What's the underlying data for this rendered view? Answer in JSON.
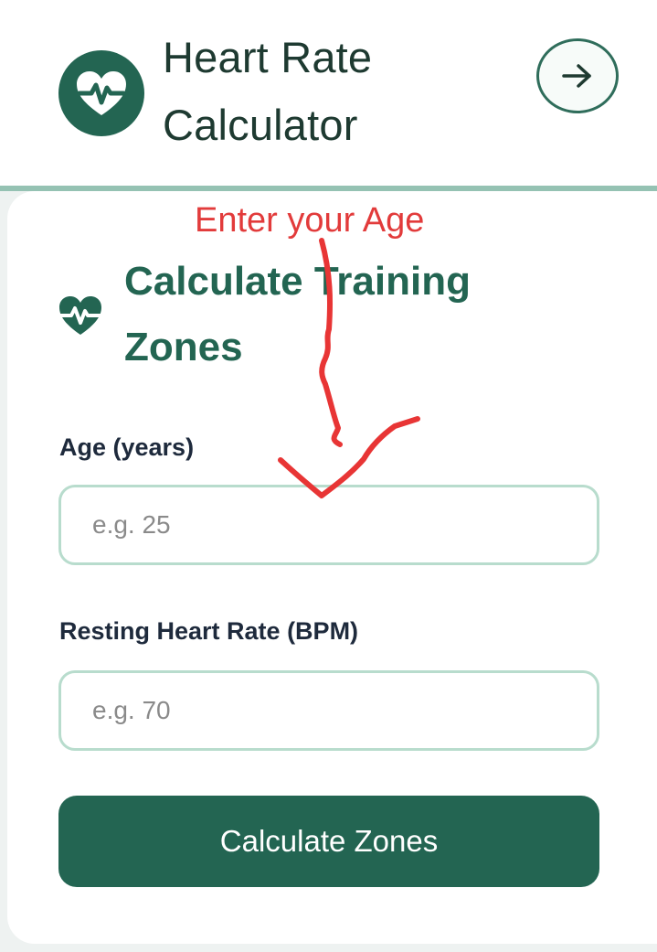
{
  "header": {
    "title": "Heart Rate Calculator"
  },
  "section": {
    "title": "Calculate Training Zones"
  },
  "form": {
    "age_label": "Age (years)",
    "age_placeholder": "e.g. 25",
    "age_value": "",
    "rhr_label": "Resting Heart Rate (BPM)",
    "rhr_placeholder": "e.g. 70",
    "rhr_value": "",
    "submit_label": "Calculate Zones"
  },
  "annotation": {
    "text": "Enter your Age"
  },
  "icons": {
    "logo": "heart-pulse-icon",
    "nav": "arrow-right-icon",
    "section": "heart-pulse-icon"
  },
  "colors": {
    "brand_green": "#236552",
    "title_dark": "#1e3a31",
    "input_border": "#b8dccd",
    "annotation_red": "#e23b3b"
  }
}
